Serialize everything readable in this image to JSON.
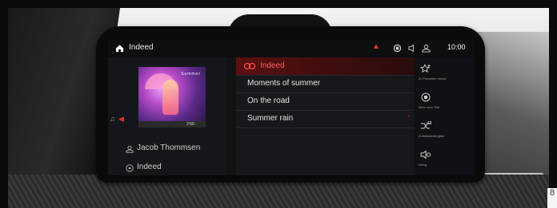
{
  "status_bar": {
    "title": "Indeed",
    "time": "10:00"
  },
  "media": {
    "album_art_text": "Summer",
    "track_time": "2:50",
    "artist": "Jacob Thommsen",
    "source": "Indeed"
  },
  "playlist": {
    "items": [
      {
        "label": "Indeed",
        "active": true
      },
      {
        "label": "Moments of summer",
        "active": false
      },
      {
        "label": "On the road",
        "active": false
      },
      {
        "label": "Summer rain",
        "active": false
      }
    ]
  },
  "actions": [
    {
      "label": "Zu Favoriten hinzuf.",
      "icon": "favorite-star-icon"
    },
    {
      "label": "Mehr zum Titel",
      "icon": "info-icon"
    },
    {
      "label": "Zufallswiedergabe",
      "icon": "shuffle-icon"
    },
    {
      "label": "Klang",
      "icon": "speaker-icon"
    }
  ],
  "page_number": "8",
  "colors": {
    "accent": "#e03a3a",
    "screen_bg": "#111214"
  }
}
